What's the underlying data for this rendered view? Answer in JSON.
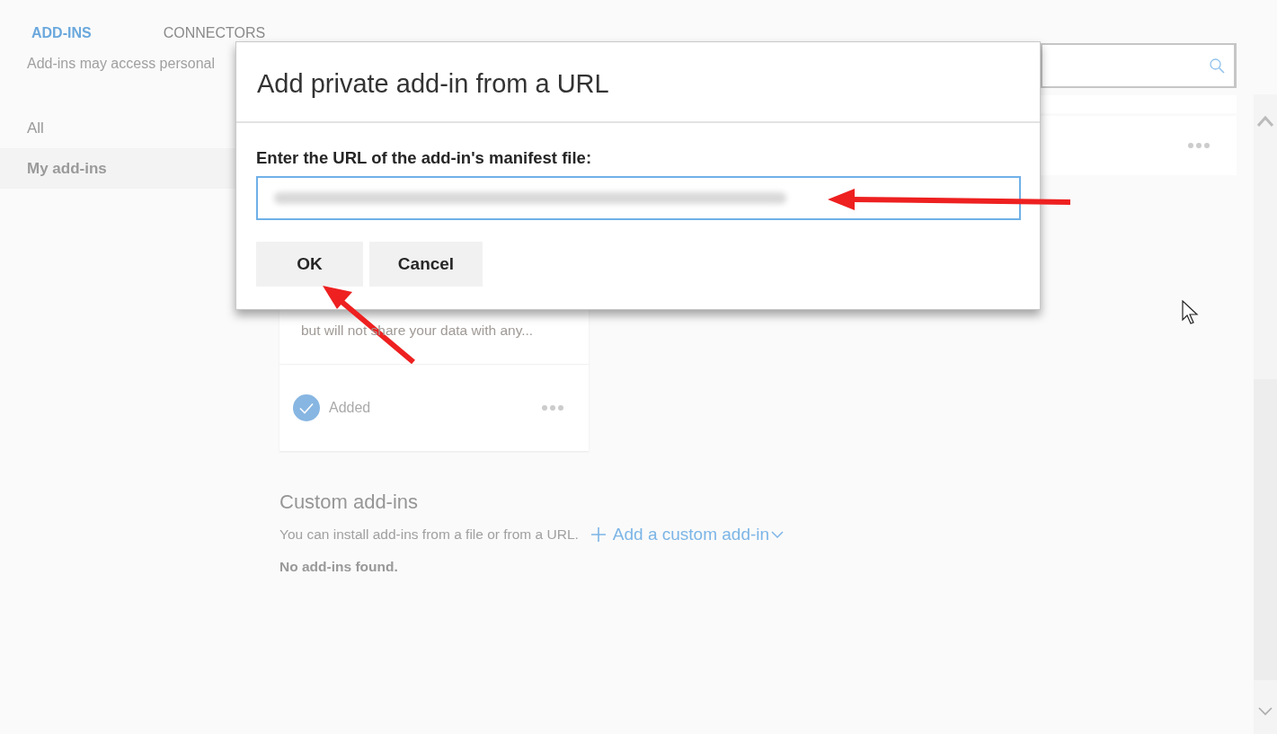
{
  "tabs": [
    {
      "label": "ADD-INS",
      "selected": true
    },
    {
      "label": "CONNECTORS",
      "selected": false
    }
  ],
  "notice": "Add-ins may access personal",
  "sidebar": {
    "items": [
      {
        "label": "All",
        "selected": false
      },
      {
        "label": "My add-ins",
        "selected": true
      }
    ]
  },
  "cards": [
    {
      "description_lines": [
        "but will not share your data with any..."
      ],
      "status": "Added",
      "added": true
    }
  ],
  "custom_addins": {
    "heading": "Custom add-ins",
    "description": "You can install add-ins from a file or from a URL.",
    "link": "Add a custom add-in",
    "empty_message": "No add-ins found."
  },
  "dialog": {
    "title": "Add private add-in from a URL",
    "field_label": "Enter the URL of the add-in's manifest file:",
    "buttons": [
      "OK",
      "Cancel"
    ]
  }
}
